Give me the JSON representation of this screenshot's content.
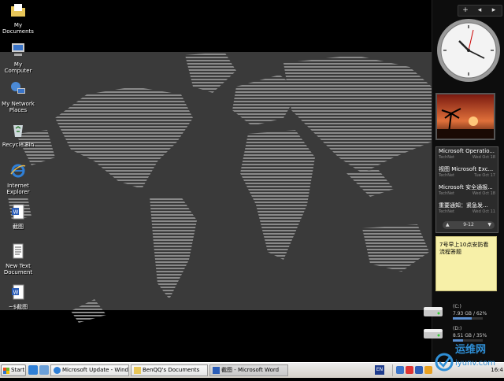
{
  "desktop_icons": [
    {
      "label": "My Documents",
      "icon": "folder-documents-icon"
    },
    {
      "label": "My Computer",
      "icon": "computer-icon"
    },
    {
      "label": "My Network Places",
      "icon": "network-places-icon"
    },
    {
      "label": "Recycle Bin",
      "icon": "recycle-bin-icon"
    },
    {
      "label": "Internet Explorer",
      "icon": "internet-explorer-icon"
    },
    {
      "label": "截图",
      "icon": "word-document-icon"
    },
    {
      "label": "New Text Document",
      "icon": "text-document-icon"
    },
    {
      "label": "~$截图",
      "icon": "word-document-icon"
    }
  ],
  "sidebar": {
    "top_buttons": [
      "+",
      "◂",
      "▸"
    ],
    "feed": {
      "items": [
        {
          "title": "Microsoft Operatio...",
          "source": "TechNet",
          "date": "Wed Oct 18"
        },
        {
          "title": "视图 Microsoft Exc...",
          "source": "TechNet",
          "date": "Tue Oct 17"
        },
        {
          "title": "Microsoft 安全通报...",
          "source": "TechNet",
          "date": "Wed Oct 18"
        },
        {
          "title": "重要通知：紧急发...",
          "source": "TechNet",
          "date": "Wed Oct 11"
        }
      ],
      "page": "9-12"
    },
    "note": "7号早上10点安防看流程答题",
    "drives": [
      {
        "name": "(C:)",
        "size": "7.93 GB / 62%",
        "percent": 62
      },
      {
        "name": "(D:)",
        "size": "8.51 GB / 35%",
        "percent": 35
      }
    ]
  },
  "taskbar": {
    "start_label": "Start",
    "tasks": [
      {
        "label": "Microsoft Update - Wind..."
      },
      {
        "label": "BenQQ's Documents"
      },
      {
        "label": "截图 - Microsoft Word"
      }
    ],
    "language": "EN",
    "time": "16:4"
  },
  "watermark": {
    "text": "运维网",
    "subtext": "iyunv.com"
  },
  "colors": {
    "accent": "#5b8fd0",
    "note": "#f7f0a8",
    "taskbar": "#d4d0c8"
  }
}
